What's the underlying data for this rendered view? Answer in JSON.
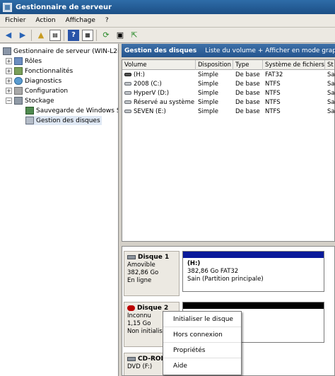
{
  "window": {
    "title": "Gestionnaire de serveur"
  },
  "menu": [
    "Fichier",
    "Action",
    "Affichage",
    "?"
  ],
  "toolbar": {
    "icons": [
      "back-arrow-icon",
      "forward-arrow-icon",
      "up-folder-icon",
      "show-hide-tree-icon",
      "help-icon",
      "list-view-icon",
      "refresh-icon",
      "properties-icon",
      "export-icon"
    ]
  },
  "tree": {
    "root": "Gestionnaire de serveur (WIN-L2EU",
    "items": {
      "roles": "Rôles",
      "features": "Fonctionnalités",
      "diagnostics": "Diagnostics",
      "configuration": "Configuration",
      "storage": "Stockage",
      "backup": "Sauvegarde de Windows Se",
      "diskmgmt": "Gestion des disques"
    }
  },
  "panel": {
    "title": "Gestion des disques",
    "subtitle": "Liste du volume + Afficher en mode graphique"
  },
  "volume_table": {
    "headers": [
      "Volume",
      "Disposition",
      "Type",
      "Système de fichiers",
      "St"
    ],
    "rows": [
      {
        "volume": "(H:)",
        "layout": "Simple",
        "type": "De base",
        "fs": "FAT32",
        "status": "Sa"
      },
      {
        "volume": "2008 (C:)",
        "layout": "Simple",
        "type": "De base",
        "fs": "NTFS",
        "status": "Sa"
      },
      {
        "volume": "HyperV (D:)",
        "layout": "Simple",
        "type": "De base",
        "fs": "NTFS",
        "status": "Sa"
      },
      {
        "volume": "Réservé au système",
        "layout": "Simple",
        "type": "De base",
        "fs": "NTFS",
        "status": "Sa"
      },
      {
        "volume": "SEVEN (E:)",
        "layout": "Simple",
        "type": "De base",
        "fs": "NTFS",
        "status": "Sa"
      }
    ]
  },
  "disks": {
    "disk1": {
      "name": "Disque 1",
      "line1": "Amovible",
      "line2": "382,86 Go",
      "line3": "En ligne",
      "part_name": "(H:)",
      "part_info": "382,86 Go FAT32",
      "part_status": "Sain (Partition principale)"
    },
    "disk2": {
      "name": "Disque 2",
      "line1": "Inconnu",
      "line2": "1,15 Go",
      "line3": "Non initialisé"
    },
    "cdrom": {
      "name": "CD-ROM",
      "line1": "DVD (F:)"
    }
  },
  "context_menu": {
    "initialize": "Initialiser le disque",
    "offline": "Hors connexion",
    "properties": "Propriétés",
    "help": "Aide"
  }
}
